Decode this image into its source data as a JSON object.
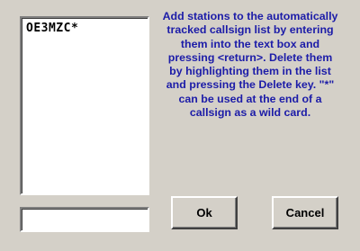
{
  "callsign_list": {
    "items": [
      "OE3MZC*"
    ]
  },
  "callsign_input": {
    "value": ""
  },
  "help_text": "Add stations to the automatically tracked callsign list by entering them into the text box and pressing <return>. Delete them by highlighting them in the list and pressing the Delete key. \"*\" can be used at the end of a callsign as a wild card.",
  "buttons": {
    "ok": {
      "mnemonic": "O",
      "rest": "k"
    },
    "cancel": {
      "mnemonic": "C",
      "rest": "ancel"
    }
  },
  "colors": {
    "dialog_background": "#d4d0c8",
    "help_text": "#1c1ca8"
  }
}
